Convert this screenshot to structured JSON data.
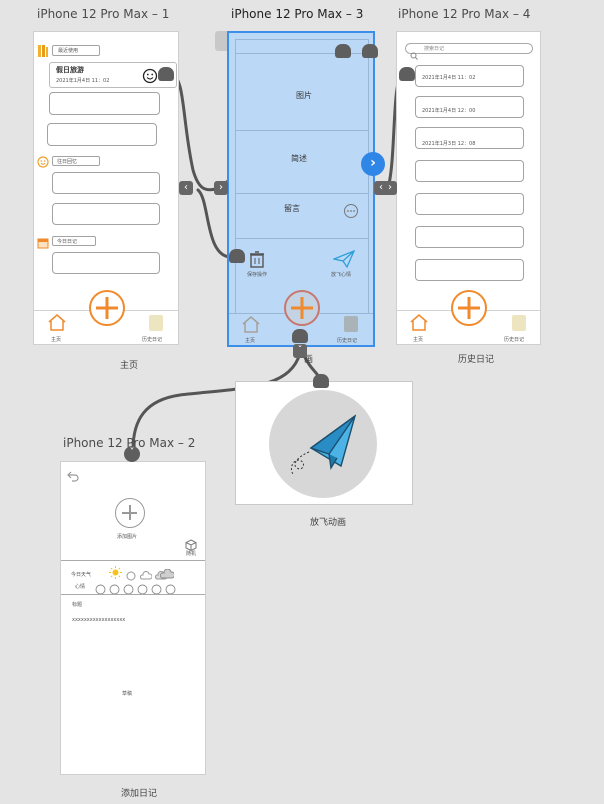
{
  "frames": {
    "f1": {
      "title": "iPhone 12 Pro Max – 1",
      "caption": "主页",
      "recent_label": "最近使用",
      "card_title": "假日旅游",
      "card_date": "2021年1月4日 11：02",
      "section_mood": "往日回忆",
      "section_today": "今日日记",
      "tab_home": "主页",
      "tab_history": "历史日记"
    },
    "f3": {
      "title": "iPhone 12 Pro Max – 3",
      "caption": "",
      "row_images": "图片",
      "row_text": "简述",
      "row_comment": "留言",
      "action_save": "保存操作",
      "action_send": "放飞心情",
      "tab_home": "主页",
      "tab_history": "历史日记"
    },
    "f4": {
      "title": "iPhone 12 Pro Max – 4",
      "caption": "历史日记",
      "search_placeholder": "搜索日记",
      "entries": [
        "2021年1月4日 11：02",
        "2021年1月4日 12：00",
        "2021年1月3日 12：08"
      ],
      "tab_home": "主页",
      "tab_history": "历史日记"
    },
    "f2": {
      "title": "iPhone 12 Pro Max – 2",
      "caption": "添加日记",
      "add_image": "添加图片",
      "random": "随机",
      "weather_label": "今日天气",
      "mood_label": "心情",
      "title_label": "标题",
      "body_text": "xxxxxxxxxxxxxxxxxx",
      "draft": "草稿"
    },
    "anim": {
      "caption": "放飞动画",
      "tag": "画"
    }
  },
  "icons": [
    "book-icon",
    "smile-icon",
    "calendar-icon",
    "home-icon",
    "history-icon",
    "trash-icon",
    "paper-plane-icon",
    "more-icon",
    "search-icon",
    "back-icon",
    "dice-icon",
    "sun-icon",
    "cloud-icon"
  ],
  "colors": {
    "accent_orange": "#f08a2c",
    "selection_blue": "#3d8ee9",
    "selected_fill": "#bcd8f7",
    "wire": "#555555",
    "plane_blue": "#2ea0d8"
  }
}
